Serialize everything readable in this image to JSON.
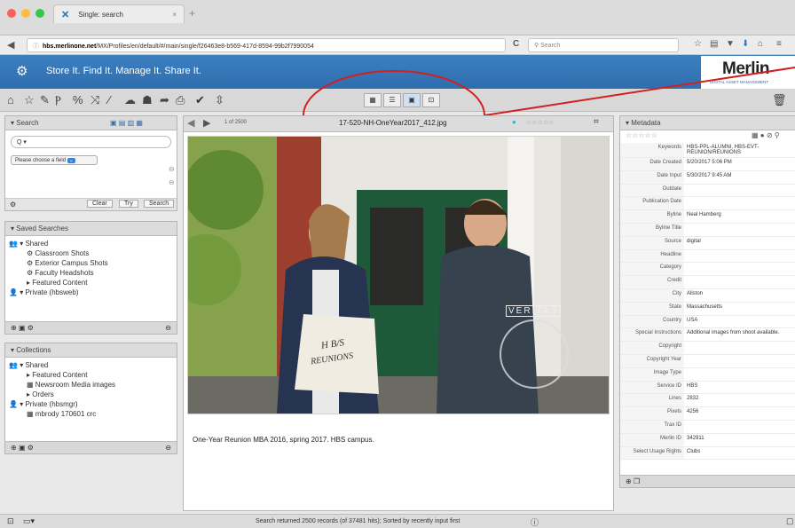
{
  "browser": {
    "tab_title": "Single: search",
    "tab_close": "×",
    "new_tab": "+",
    "url_host": "hbs.merlinone.net",
    "url_path": "/MX/Profiles/en/default/#/main/single/f26463e8-b569-417d-8594-99b2f7990054",
    "search_placeholder": "Search",
    "info_icon": "ⓘ",
    "reload_icon": "C"
  },
  "banner": {
    "slogan": "Store It. Find It. Manage It. Share It."
  },
  "logo": {
    "name": "Merlin",
    "tagline": "DIGITAL ASSET MANAGEMENT"
  },
  "toolbar": {
    "badge": "1"
  },
  "search_panel": {
    "title": "Search",
    "query": "Q ▾",
    "field_select": "Please choose a field",
    "clear": "Clear",
    "try": "Try",
    "search": "Search"
  },
  "saved_searches": {
    "title": "Saved Searches",
    "shared_label": "Shared",
    "items": [
      "Classroom Shots",
      "Exterior Campus Shots",
      "Faculty Headshots",
      "Featured Content"
    ],
    "private_label": "Private (hbsweb)"
  },
  "collections": {
    "title": "Collections",
    "shared_label": "Shared",
    "items": [
      "Featured Content",
      "Newsroom Media images",
      "Orders"
    ],
    "private_label": "Private (hbsmgr)",
    "private_items": [
      "mbrody 170601 crc"
    ]
  },
  "viewer": {
    "counter": "1 of 2500",
    "filename": "17-520-NH-OneYear2017_412.jpg",
    "caption": "One-Year Reunion MBA 2016, spring 2017. HBS campus.",
    "bag_text_1": "H B/S",
    "bag_text_2": "REUNIONS",
    "watermark": "VERITAS"
  },
  "metadata": {
    "title": "Metadata",
    "rating": "☆☆☆☆☆",
    "fields": [
      {
        "k": "Keywords",
        "v": "HBS-PPL-ALUMNI, HBS-EVT-REUNION/REUNIONS"
      },
      {
        "k": "Date Created",
        "v": "5/20/2017 5:06 PM"
      },
      {
        "k": "Date Input",
        "v": "5/30/2017 9:45 AM"
      },
      {
        "k": "Outdate",
        "v": ""
      },
      {
        "k": "Publication Date",
        "v": ""
      },
      {
        "k": "Byline",
        "v": "Neal Hamberg"
      },
      {
        "k": "Byline Title",
        "v": ""
      },
      {
        "k": "Source",
        "v": "digital"
      },
      {
        "k": "Headline",
        "v": ""
      },
      {
        "k": "Category",
        "v": ""
      },
      {
        "k": "Credit",
        "v": ""
      },
      {
        "k": "City",
        "v": "Allston"
      },
      {
        "k": "State",
        "v": "Massachusetts"
      },
      {
        "k": "Country",
        "v": "USA"
      },
      {
        "k": "Special Instructions",
        "v": "Additional images from shoot available."
      },
      {
        "k": "Copyright",
        "v": ""
      },
      {
        "k": "Copyright Year",
        "v": ""
      },
      {
        "k": "Image Type",
        "v": ""
      },
      {
        "k": "Service ID",
        "v": "HBS"
      },
      {
        "k": "Lines",
        "v": "2832"
      },
      {
        "k": "Pixels",
        "v": "4256"
      },
      {
        "k": "Trax ID",
        "v": ""
      },
      {
        "k": "Merlin ID",
        "v": "342911"
      },
      {
        "k": "Select Usage Rights",
        "v": "Clubs"
      }
    ]
  },
  "status": {
    "text": "Search returned 2500 records (of 37481 hits); Sorted by recently input first"
  }
}
